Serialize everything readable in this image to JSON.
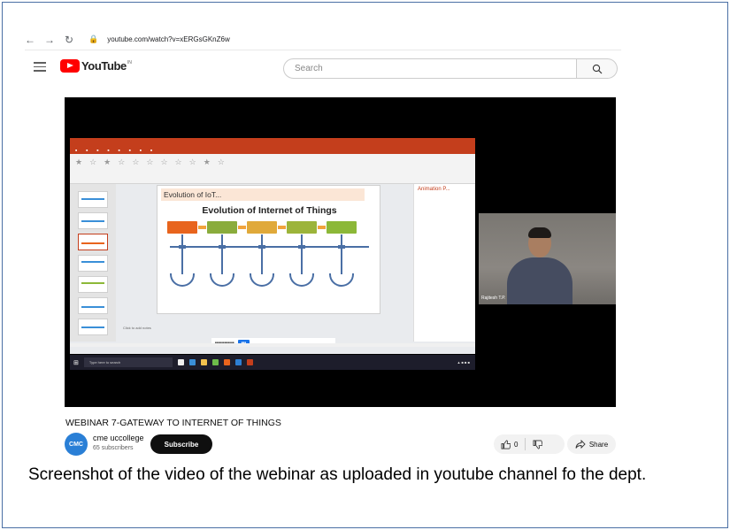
{
  "browser": {
    "url": "youtube.com/watch?v=xERGsGKnZ6w"
  },
  "youtube": {
    "logo_text": "YouTube",
    "region": "IN",
    "search_placeholder": "Search"
  },
  "video": {
    "title": "WEBINAR 7-GATEWAY TO INTERNET OF THINGS",
    "channel_name": "cme uccollege",
    "channel_initials": "CMC",
    "subscribers": "65 subscribers",
    "subscribe_label": "Subscribe",
    "likes": "0",
    "share_label": "Share"
  },
  "screen_share": {
    "slide_heading": "Evolution of IoT...",
    "slide_title": "Evolution of Internet of Things",
    "animation_pane_title": "Animation P...",
    "notes_hint": "Click to add notes",
    "taskbar_search": "Type here to search",
    "participant_name": "Rajitesh T.P."
  },
  "caption": "Screenshot of the video of the webinar as uploaded in youtube channel fo the dept.",
  "colors": {
    "youtube_red": "#ff0000",
    "ppt_orange": "#c43e1c",
    "frame_border": "#4a6fa5",
    "stage_colors": [
      "#e8641d",
      "#8aac3c",
      "#e0a93a",
      "#9cb43a",
      "#8cb838"
    ]
  },
  "icons": {
    "back": "arrow-left-icon",
    "forward": "arrow-right-icon",
    "reload": "reload-icon",
    "lock": "lock-icon",
    "menu": "hamburger-icon",
    "search": "magnifier-icon",
    "like": "thumbs-up-icon",
    "dislike": "thumbs-down-icon",
    "share": "share-arrow-icon"
  }
}
